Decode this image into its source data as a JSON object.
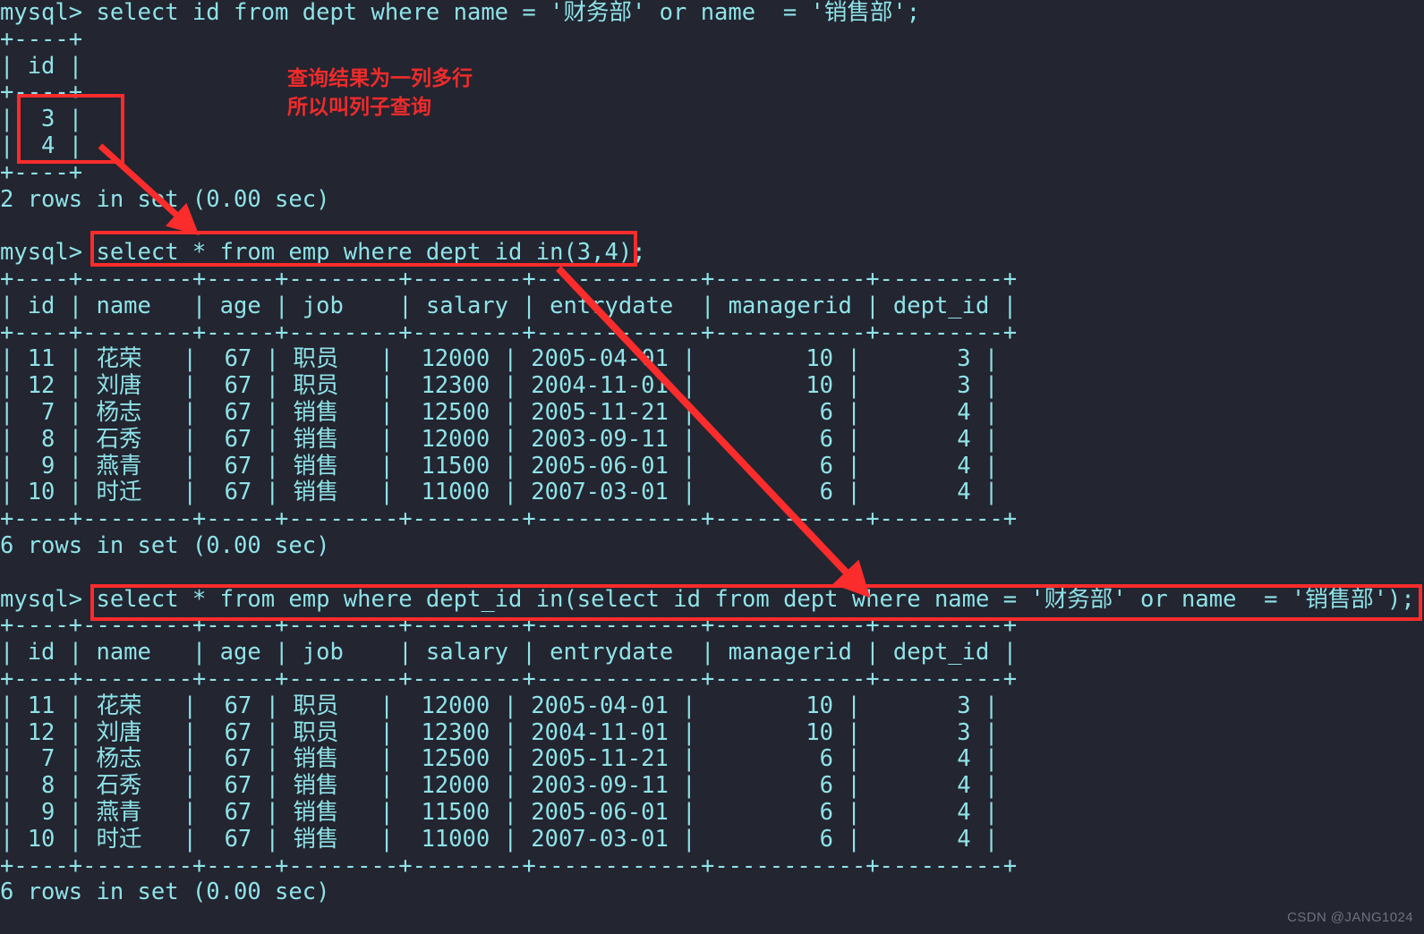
{
  "terminal": {
    "prompt": "mysql> ",
    "background_color": "#232530",
    "text_color": "#8fe3e8",
    "accent_color": "#fb2c2c",
    "lines": [
      "mysql> select id from dept where name = '财务部' or name  = '销售部';",
      "+----+",
      "| id |",
      "+----+",
      "|  3 |",
      "|  4 |",
      "+----+",
      "2 rows in set (0.00 sec)",
      "",
      "mysql> select * from emp where dept_id in(3,4);",
      "+----+--------+-----+--------+--------+------------+-----------+---------+",
      "| id | name   | age | job    | salary | entrydate  | managerid | dept_id |",
      "+----+--------+-----+--------+--------+------------+-----------+---------+",
      "| 11 | 花荣   |  67 | 职员   |  12000 | 2005-04-01 |        10 |       3 |",
      "| 12 | 刘唐   |  67 | 职员   |  12300 | 2004-11-01 |        10 |       3 |",
      "|  7 | 杨志   |  67 | 销售   |  12500 | 2005-11-21 |         6 |       4 |",
      "|  8 | 石秀   |  67 | 销售   |  12000 | 2003-09-11 |         6 |       4 |",
      "|  9 | 燕青   |  67 | 销售   |  11500 | 2005-06-01 |         6 |       4 |",
      "| 10 | 时迁   |  67 | 销售   |  11000 | 2007-03-01 |         6 |       4 |",
      "+----+--------+-----+--------+--------+------------+-----------+---------+",
      "6 rows in set (0.00 sec)",
      "",
      "mysql> select * from emp where dept_id in(select id from dept where name = '财务部' or name  = '销售部');",
      "+----+--------+-----+--------+--------+------------+-----------+---------+",
      "| id | name   | age | job    | salary | entrydate  | managerid | dept_id |",
      "+----+--------+-----+--------+--------+------------+-----------+---------+",
      "| 11 | 花荣   |  67 | 职员   |  12000 | 2005-04-01 |        10 |       3 |",
      "| 12 | 刘唐   |  67 | 职员   |  12300 | 2004-11-01 |        10 |       3 |",
      "|  7 | 杨志   |  67 | 销售   |  12500 | 2005-11-21 |         6 |       4 |",
      "|  8 | 石秀   |  67 | 销售   |  12000 | 2003-09-11 |         6 |       4 |",
      "|  9 | 燕青   |  67 | 销售   |  11500 | 2005-06-01 |         6 |       4 |",
      "| 10 | 时迁   |  67 | 销售   |  11000 | 2007-03-01 |         6 |       4 |",
      "+----+--------+-----+--------+--------+------------+-----------+---------+",
      "6 rows in set (0.00 sec)"
    ],
    "queries": {
      "first": "select id from dept where name = '财务部' or name  = '销售部';",
      "second": "select * from emp where dept_id in(3,4);",
      "third": "select * from emp where dept_id in(select id from dept where name = '财务部' or name  = '销售部');"
    },
    "result_status": {
      "first": "2 rows in set (0.00 sec)",
      "second": "6 rows in set (0.00 sec)",
      "third": "6 rows in set (0.00 sec)"
    },
    "dept_result": {
      "header": "id",
      "values": [
        "3",
        "4"
      ]
    },
    "emp_table": {
      "columns": [
        "id",
        "name",
        "age",
        "job",
        "salary",
        "entrydate",
        "managerid",
        "dept_id"
      ],
      "rows": [
        [
          "11",
          "花荣",
          "67",
          "职员",
          "12000",
          "2005-04-01",
          "10",
          "3"
        ],
        [
          "12",
          "刘唐",
          "67",
          "职员",
          "12300",
          "2004-11-01",
          "10",
          "3"
        ],
        [
          "7",
          "杨志",
          "67",
          "销售",
          "12500",
          "2005-11-21",
          "6",
          "4"
        ],
        [
          "8",
          "石秀",
          "67",
          "销售",
          "12000",
          "2003-09-11",
          "6",
          "4"
        ],
        [
          "9",
          "燕青",
          "67",
          "销售",
          "11500",
          "2005-06-01",
          "6",
          "4"
        ],
        [
          "10",
          "时迁",
          "67",
          "销售",
          "11000",
          "2007-03-01",
          "6",
          "4"
        ]
      ]
    }
  },
  "annotations": {
    "note_line1": "查询结果为一列多行",
    "note_line2": "所以叫列子查询"
  },
  "watermark": "CSDN @JANG1024"
}
